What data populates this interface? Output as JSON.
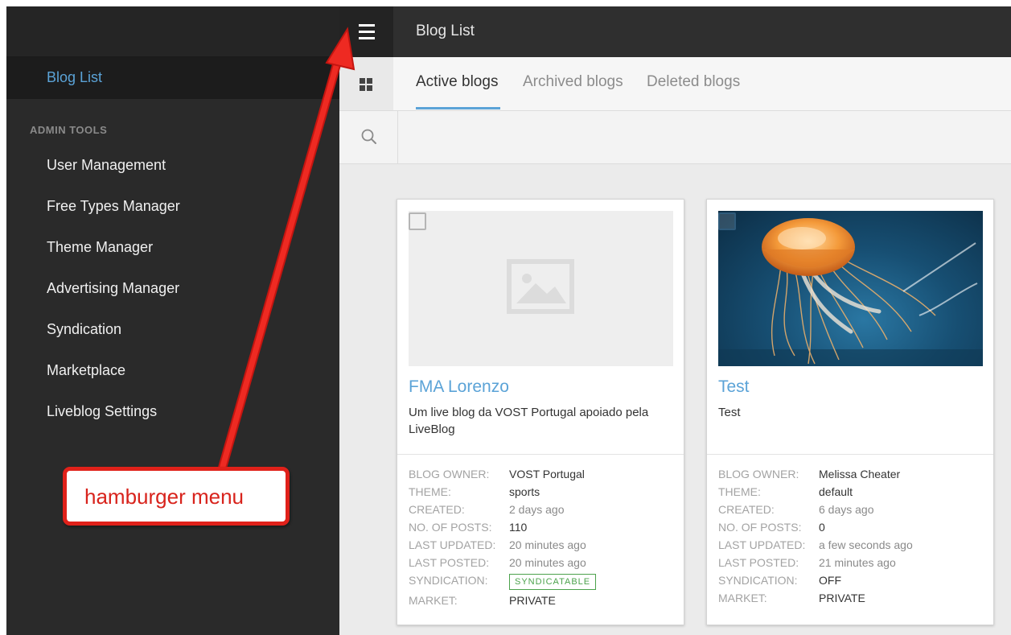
{
  "topbar": {
    "title": "Blog List",
    "menu_icon": "hamburger-icon"
  },
  "sidebar": {
    "active_item": "Blog List",
    "section_heading": "ADMIN TOOLS",
    "items": [
      {
        "label": "User Management"
      },
      {
        "label": "Free Types Manager"
      },
      {
        "label": "Theme Manager"
      },
      {
        "label": "Advertising Manager"
      },
      {
        "label": "Syndication"
      },
      {
        "label": "Marketplace"
      },
      {
        "label": "Liveblog Settings"
      }
    ]
  },
  "tabs": {
    "view_icon": "grid-view-icon",
    "items": [
      {
        "label": "Active blogs",
        "active": true
      },
      {
        "label": "Archived blogs",
        "active": false
      },
      {
        "label": "Deleted blogs",
        "active": false
      }
    ]
  },
  "search": {
    "icon": "search-icon",
    "placeholder": ""
  },
  "blogs": [
    {
      "title": "FMA Lorenzo",
      "description": "Um live blog da VOST Portugal apoiado pela LiveBlog",
      "thumbnail": "image-placeholder-icon",
      "labels": {
        "owner": "BLOG OWNER:",
        "theme": "THEME:",
        "created": "CREATED:",
        "posts": "NO. OF POSTS:",
        "updated": "LAST UPDATED:",
        "posted": "LAST POSTED:",
        "syndication": "SYNDICATION:",
        "market": "MARKET:"
      },
      "owner": "VOST Portugal",
      "theme": "sports",
      "created": "2 days ago",
      "posts": "110",
      "updated": "20 minutes ago",
      "posted": "20 minutes ago",
      "syndication": "SYNDICATABLE",
      "market": "PRIVATE"
    },
    {
      "title": "Test",
      "description": "Test",
      "thumbnail": "jellyfish-photo",
      "labels": {
        "owner": "BLOG OWNER:",
        "theme": "THEME:",
        "created": "CREATED:",
        "posts": "NO. OF POSTS:",
        "updated": "LAST UPDATED:",
        "posted": "LAST POSTED:",
        "syndication": "SYNDICATION:",
        "market": "MARKET:"
      },
      "owner": "Melissa Cheater",
      "theme": "default",
      "created": "6 days ago",
      "posts": "0",
      "updated": "a few seconds ago",
      "posted": "21 minutes ago",
      "syndication": "OFF",
      "market": "PRIVATE"
    }
  ],
  "annotation": {
    "text": "hamburger menu",
    "color": "#e0211a"
  },
  "colors": {
    "accent": "#5ba3d7",
    "sidebar_bg": "#2a2a2a",
    "syndicatable": "#4ca24c"
  }
}
